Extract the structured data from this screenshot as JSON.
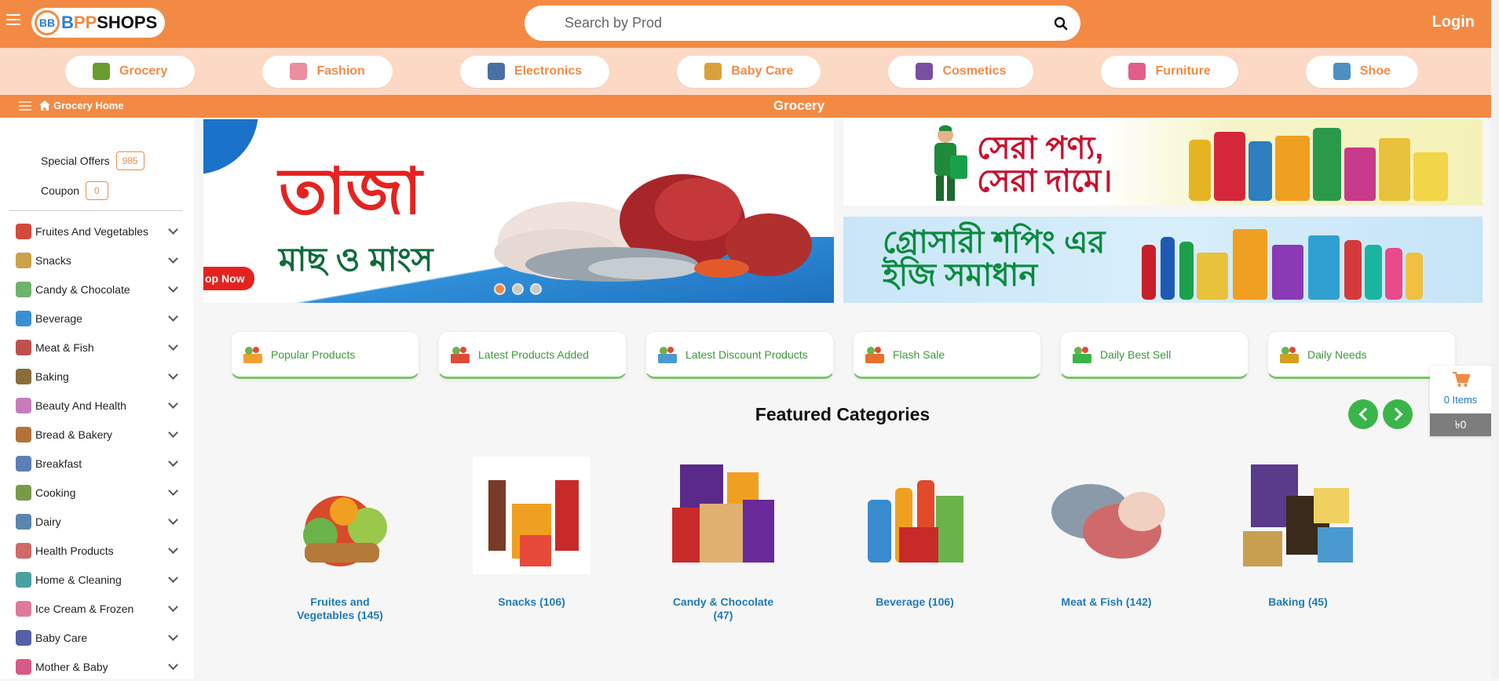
{
  "header": {
    "logo_text_b": "B",
    "logo_text_pp": "PP",
    "logo_text_s": "SHOPS",
    "logo_mark": "BB",
    "search_placeholder": "Search by Prod",
    "login_label": "Login"
  },
  "categories": [
    {
      "label": "Grocery",
      "icon": "grocery-basket-icon",
      "color": "#6a9c2f"
    },
    {
      "label": "Fashion",
      "icon": "fashion-icon",
      "color": "#e98fa0"
    },
    {
      "label": "Electronics",
      "icon": "electronics-icon",
      "color": "#4a6fa5"
    },
    {
      "label": "Baby Care",
      "icon": "baby-care-icon",
      "color": "#d9a13a"
    },
    {
      "label": "Cosmetics",
      "icon": "cosmetics-icon",
      "color": "#7a4fa0"
    },
    {
      "label": "Furniture",
      "icon": "furniture-icon",
      "color": "#e25d8a"
    },
    {
      "label": "Shoe",
      "icon": "shoe-icon",
      "color": "#4f8fbf"
    }
  ],
  "breadcrumb": {
    "home_label": "Grocery Home",
    "page_title": "Grocery"
  },
  "sidebar": {
    "special_offers_label": "Special Offers",
    "special_offers_count": "985",
    "coupon_label": "Coupon",
    "coupon_count": "0",
    "items": [
      {
        "label": "Fruites And Vegetables",
        "color": "#d24a3a"
      },
      {
        "label": "Snacks",
        "color": "#c9a24a"
      },
      {
        "label": "Candy & Chocolate",
        "color": "#6db36b"
      },
      {
        "label": "Beverage",
        "color": "#3b8fd1"
      },
      {
        "label": "Meat & Fish",
        "color": "#c0504d"
      },
      {
        "label": "Baking",
        "color": "#8a6d3b"
      },
      {
        "label": "Beauty And Health",
        "color": "#c77dbb"
      },
      {
        "label": "Bread & Bakery",
        "color": "#b4713a"
      },
      {
        "label": "Breakfast",
        "color": "#5b7fb5"
      },
      {
        "label": "Cooking",
        "color": "#7a9a4a"
      },
      {
        "label": "Dairy",
        "color": "#5a86b0"
      },
      {
        "label": "Health Products",
        "color": "#d06a6a"
      },
      {
        "label": "Home & Cleaning",
        "color": "#4aa0a0"
      },
      {
        "label": "Ice Cream & Frozen",
        "color": "#e07a9a"
      },
      {
        "label": "Baby Care",
        "color": "#5560a8"
      },
      {
        "label": "Mother & Baby",
        "color": "#d85a8a"
      }
    ]
  },
  "banners": {
    "main_title": "তাজা",
    "main_subtitle": "মাছ ও মাংস",
    "main_button": "op Now",
    "side1_text_line1": "সেরা পণ্য,",
    "side1_text_line2": "সেরা দামে।",
    "side2_text_line1": "গ্রোসারী শপিং এর",
    "side2_text_line2": "ইজি সমাধান"
  },
  "product_tabs": [
    {
      "label": "Popular Products"
    },
    {
      "label": "Latest Products Added"
    },
    {
      "label": "Latest Discount Products"
    },
    {
      "label": "Flash Sale"
    },
    {
      "label": "Daily Best Sell"
    },
    {
      "label": "Daily Needs"
    }
  ],
  "featured": {
    "title": "Featured Categories",
    "items": [
      {
        "label": "Fruites and Vegetables (145)"
      },
      {
        "label": "Snacks (106)"
      },
      {
        "label": "Candy & Chocolate (47)"
      },
      {
        "label": "Beverage (106)"
      },
      {
        "label": "Meat & Fish (142)"
      },
      {
        "label": "Baking (45)"
      }
    ]
  },
  "cart": {
    "items_label": "0 Items",
    "total_label": "৳0"
  },
  "colors": {
    "brand_orange": "#f28a44",
    "light_orange": "#fcd9c4",
    "green_accent": "#3ab54a",
    "link_blue": "#1f7ab8"
  }
}
